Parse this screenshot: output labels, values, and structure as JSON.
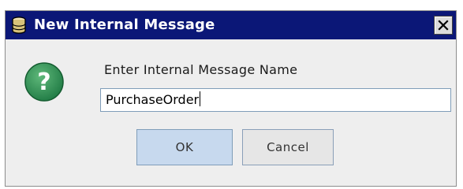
{
  "dialog": {
    "title": "New Internal Message",
    "title_icon": "database-jar-icon",
    "close_icon": "close-x-icon",
    "prompt_icon": "question-mark-icon",
    "prompt": "Enter Internal Message Name",
    "input_value": "PurchaseOrder",
    "ok_label": "OK",
    "cancel_label": "Cancel"
  },
  "colors": {
    "titlebar": "#0b1777",
    "dialog_bg": "#eeeeee",
    "question_icon": "#2e8b57",
    "ok_button": "#c7d9ee"
  }
}
